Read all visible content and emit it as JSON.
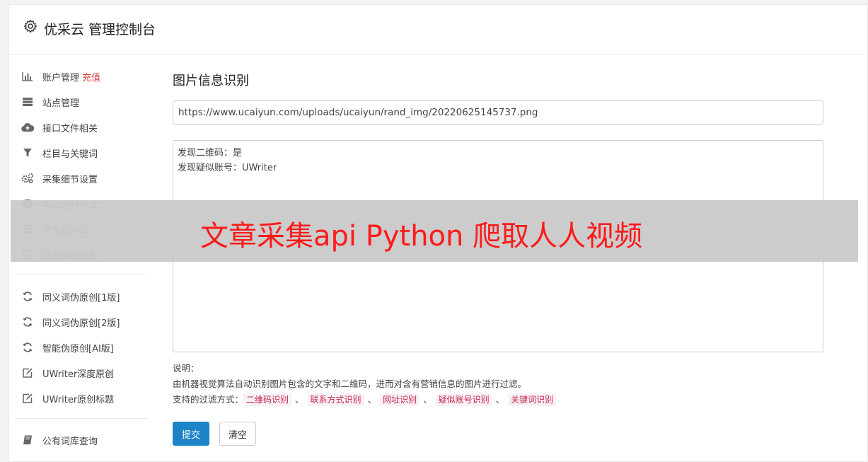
{
  "app": {
    "title": "优采云 管理控制台"
  },
  "sidebar": {
    "groups": [
      [
        {
          "label": "账户管理",
          "badge": "充值",
          "icon": "bar-chart-icon"
        },
        {
          "label": "站点管理",
          "icon": "server-icon"
        },
        {
          "label": "接口文件相关",
          "icon": "cloud-upload-icon"
        },
        {
          "label": "栏目与关键词",
          "icon": "filter-icon"
        },
        {
          "label": "采集细节设置",
          "icon": "cogs-icon"
        },
        {
          "label": "手动运行测试",
          "icon": "play-circle-icon"
        },
        {
          "label": "文章暂存库",
          "icon": "database-icon"
        },
        {
          "label": "深度原创任务",
          "icon": "edit-icon"
        }
      ],
      [
        {
          "label": "同义词伪原创[1版]",
          "icon": "refresh-icon"
        },
        {
          "label": "同义词伪原创[2版]",
          "icon": "refresh-icon"
        },
        {
          "label": "智能伪原创[AI版]",
          "icon": "refresh-icon"
        },
        {
          "label": "UWriter深度原创",
          "icon": "edit-icon"
        },
        {
          "label": "UWriter原创标题",
          "icon": "edit-icon"
        }
      ],
      [
        {
          "label": "公有词库查询",
          "icon": "book-icon"
        }
      ]
    ]
  },
  "main": {
    "heading": "图片信息识别",
    "url_value": "https://www.ucaiyun.com/uploads/ucaiyun/rand_img/20220625145737.png",
    "result_lines": [
      "发现二维码：是",
      "发现疑似账号：UWriter"
    ],
    "notes_title": "说明：",
    "notes_desc": "由机器视觉算法自动识别图片包含的文字和二维码，进而对含有营销信息的图片进行过滤。",
    "filter_label": "支持的过滤方式：",
    "filter_tags": [
      "二维码识别",
      "联系方式识别",
      "网址识别",
      "疑似账号识别",
      "关键词识别"
    ],
    "tag_separator": "、",
    "submit_label": "提交",
    "clear_label": "清空"
  },
  "overlay": {
    "text": "文章采集api Python 爬取人人视频"
  }
}
